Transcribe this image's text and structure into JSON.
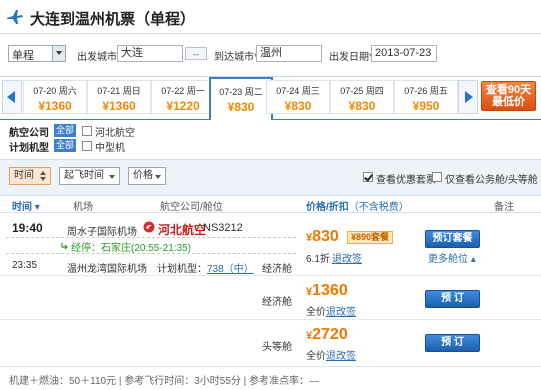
{
  "header": {
    "title": "大连到温州机票（单程）"
  },
  "search": {
    "trip_type": "单程",
    "from_label": "出发城市",
    "from_value": "大连",
    "swap_label": "↔",
    "to_label": "到达城市",
    "to_value": "温州",
    "date_label": "出发日期",
    "date_value": "2013-07-23",
    "required_mark": "*"
  },
  "date_strip": {
    "days": [
      {
        "date": "07-20 周六",
        "price": "¥1360"
      },
      {
        "date": "07-21 周日",
        "price": "¥1360"
      },
      {
        "date": "07-22 周一",
        "price": "¥1220"
      },
      {
        "date": "07-23 周二",
        "price": "¥830"
      },
      {
        "date": "07-24 周三",
        "price": "¥830"
      },
      {
        "date": "07-25 周四",
        "price": "¥830"
      },
      {
        "date": "07-26 周五",
        "price": "¥950"
      }
    ],
    "active_index": 3,
    "cta_line1": "查看90天",
    "cta_line2": "最低价"
  },
  "filters": {
    "airline_label": "航空公司",
    "airline_all": "全部",
    "airline_option": "河北航空",
    "aircraft_label": "计划机型",
    "aircraft_all": "全部",
    "aircraft_option": "中型机"
  },
  "sortbar": {
    "time_btn": "时间",
    "depart_btn": "起飞时间",
    "price_btn": "价格",
    "check_discount": "查看优惠套票",
    "check_business": "仅查看公务舱/头等舱"
  },
  "table_header": {
    "time": "时间",
    "airport": "机场",
    "airline_cabin": "航空公司/舱位",
    "price_discount": "价格/折扣",
    "tax_note": "（不含税费）",
    "remarks": "备注"
  },
  "flight": {
    "dep_time": "19:40",
    "dep_airport": "周水子国际机场",
    "airline": "河北航空",
    "flight_no": "NS3212",
    "stopover": "经停：石家庄(20:55-21:35)",
    "arr_time": "23:35",
    "arr_airport": "温州龙湾国际机场",
    "aircraft_label": "计划机型：",
    "aircraft": "738（中）"
  },
  "fares": [
    {
      "cabin": "经济舱",
      "price": "830",
      "badge": "¥890套餐",
      "discount": "6.1折",
      "refund": "退改签",
      "button": "预订套餐",
      "more": "更多舱位"
    },
    {
      "cabin": "经济舱",
      "price": "1360",
      "discount": "全价",
      "refund": "退改签",
      "button": "预 订"
    },
    {
      "cabin": "头等舱",
      "price": "2720",
      "discount": "全价",
      "refund": "退改签",
      "button": "预 订"
    }
  ],
  "currency": "¥",
  "footer": {
    "text": "机建＋燃油：50＋110元 | 参考飞行时间：3小时55分 | 参考准点率：—"
  },
  "colors": {
    "accent": "#3e7fc1",
    "price": "#f07800",
    "cta": "#e05a14"
  }
}
